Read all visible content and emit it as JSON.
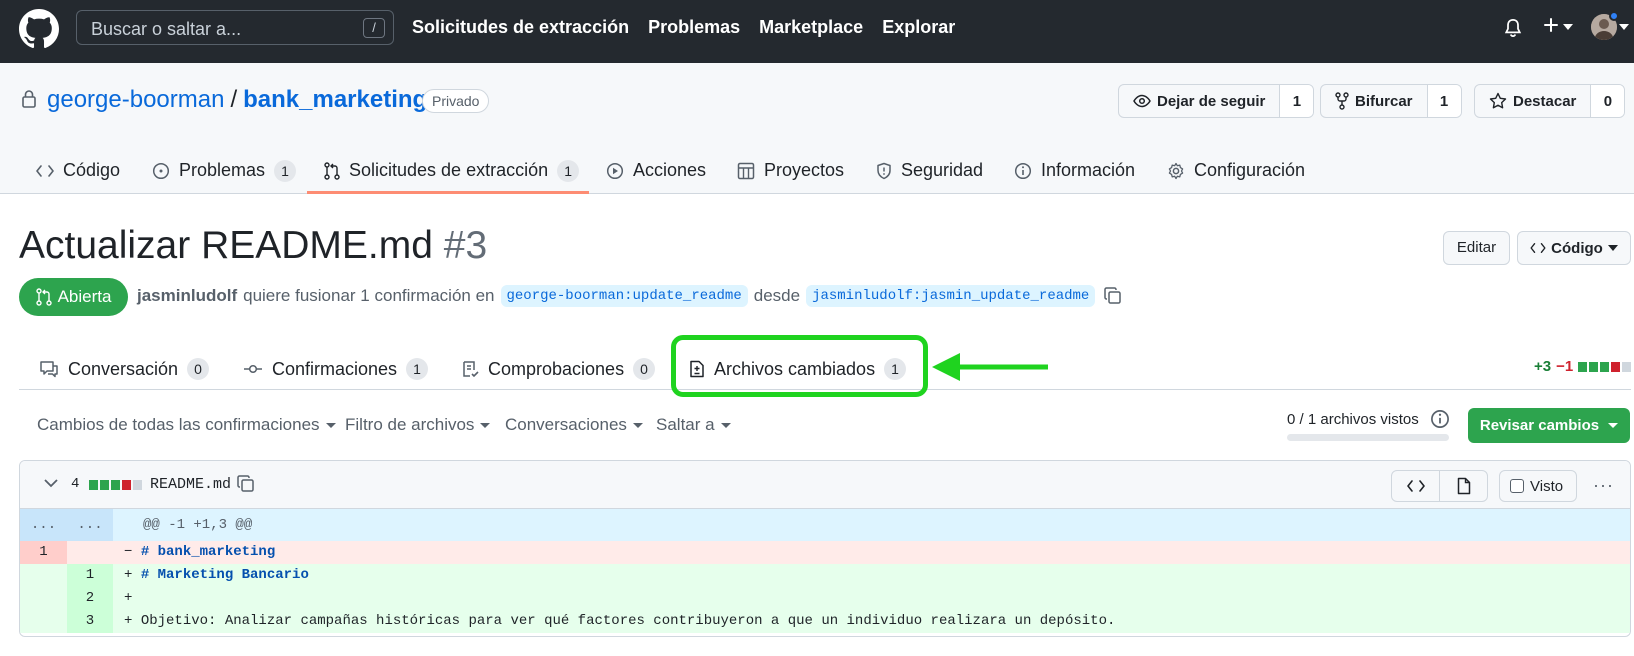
{
  "header": {
    "search_placeholder": "Buscar o saltar a...",
    "search_shortcut": "/",
    "nav": [
      "Solicitudes de extracción",
      "Problemas",
      "Marketplace",
      "Explorar"
    ],
    "icons": [
      "github-logo-icon",
      "bell-icon",
      "plus-icon",
      "avatar"
    ]
  },
  "repo": {
    "owner": "george-boorman",
    "separator": "/",
    "name": "bank_marketing",
    "visibility": "Privado",
    "watch_label": "Dejar de seguir",
    "watch_count": "1",
    "fork_label": "Bifurcar",
    "fork_count": "1",
    "star_label": "Destacar",
    "star_count": "0"
  },
  "repo_nav": {
    "items": [
      {
        "label": "Código",
        "icon": "code-icon"
      },
      {
        "label": "Problemas",
        "icon": "issue-icon",
        "count": "1"
      },
      {
        "label": "Solicitudes de extracción",
        "icon": "pull-request-icon",
        "count": "1"
      },
      {
        "label": "Acciones",
        "icon": "play-icon"
      },
      {
        "label": "Proyectos",
        "icon": "table-icon"
      },
      {
        "label": "Seguridad",
        "icon": "shield-icon"
      },
      {
        "label": "Información",
        "icon": "info-icon"
      },
      {
        "label": "Configuración",
        "icon": "gear-icon"
      }
    ],
    "active_index": 2
  },
  "pr": {
    "title": "Actualizar README.md",
    "number": "#3",
    "edit_label": "Editar",
    "code_label": "Código",
    "state": "Abierta",
    "author": "jasminludolf",
    "meta_text_1": "quiere fusionar 1 confirmación en",
    "base_branch": "george-boorman:update_readme",
    "meta_text_2": "desde",
    "head_branch": "jasminludolf:jasmin_update_readme"
  },
  "pr_tabs": {
    "items": [
      {
        "label": "Conversación",
        "count": "0",
        "icon": "comment-icon"
      },
      {
        "label": "Confirmaciones",
        "count": "1",
        "icon": "commit-icon"
      },
      {
        "label": "Comprobaciones",
        "count": "0",
        "icon": "checklist-icon"
      },
      {
        "label": "Archivos cambiados",
        "count": "1",
        "icon": "file-diff-icon"
      }
    ],
    "highlighted_index": 3,
    "additions": "+3",
    "deletions": "−1",
    "highlight_color": "#1fd31f"
  },
  "toolbar": {
    "filters": [
      "Cambios de todas las confirmaciones",
      "Filtro de archivos",
      "Conversaciones",
      "Saltar a"
    ],
    "viewed": "0 / 1 archivos vistos",
    "viewed_fraction": 0,
    "review_label": "Revisar cambios"
  },
  "file": {
    "changes": "4",
    "name": "README.md",
    "viewed_label": "Visto",
    "more": "···",
    "hunk_left": "...",
    "hunk_right": "...",
    "hunk": "@@ -1 +1,3 @@",
    "lines": [
      {
        "type": "del",
        "old": "1",
        "new": "",
        "sign": "−",
        "kw": "# bank_marketing",
        "text": ""
      },
      {
        "type": "add",
        "old": "",
        "new": "1",
        "sign": "+",
        "kw": "# Marketing Bancario",
        "text": ""
      },
      {
        "type": "add",
        "old": "",
        "new": "2",
        "sign": "+",
        "kw": "",
        "text": ""
      },
      {
        "type": "add",
        "old": "",
        "new": "3",
        "sign": "+",
        "kw": "",
        "text": "Objetivo: Analizar campañas históricas para ver qué factores contribuyeron a que un individuo realizara un depósito."
      }
    ]
  },
  "colors": {
    "header_bg": "#24292f",
    "link": "#0969da",
    "green": "#2da44e",
    "red": "#cf222e",
    "tab_underline": "#fd8c73"
  }
}
